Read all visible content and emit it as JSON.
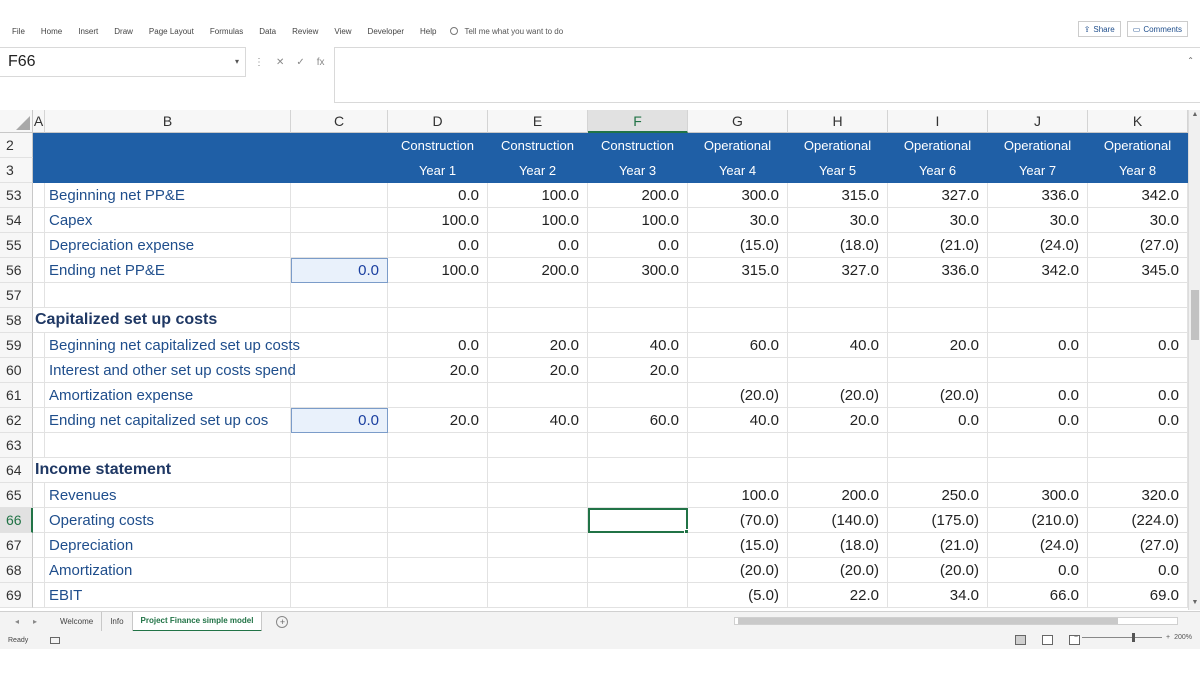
{
  "ribbon": {
    "tabs": [
      "File",
      "Home",
      "Insert",
      "Draw",
      "Page Layout",
      "Formulas",
      "Data",
      "Review",
      "View",
      "Developer",
      "Help"
    ],
    "tell_me": "Tell me what you want to do",
    "share": "Share",
    "comments": "Comments"
  },
  "namebox": {
    "value": "F66"
  },
  "formula_bar": {
    "fx": "fx",
    "content": ""
  },
  "columns": [
    {
      "letter": "A",
      "selected": false
    },
    {
      "letter": "B",
      "selected": false
    },
    {
      "letter": "C",
      "selected": false
    },
    {
      "letter": "D",
      "selected": false
    },
    {
      "letter": "E",
      "selected": false
    },
    {
      "letter": "F",
      "selected": true
    },
    {
      "letter": "G",
      "selected": false
    },
    {
      "letter": "H",
      "selected": false
    },
    {
      "letter": "I",
      "selected": false
    },
    {
      "letter": "J",
      "selected": false
    },
    {
      "letter": "K",
      "selected": false
    }
  ],
  "header_rows": [
    {
      "row": "2",
      "values": [
        "Construction",
        "Construction",
        "Construction",
        "Operational",
        "Operational",
        "Operational",
        "Operational",
        "Operational"
      ]
    },
    {
      "row": "3",
      "values": [
        "Year 1",
        "Year 2",
        "Year 3",
        "Year 4",
        "Year 5",
        "Year 6",
        "Year 7",
        "Year 8"
      ]
    }
  ],
  "rows": [
    {
      "row": "53",
      "type": "line",
      "label": "Beginning net PP&E",
      "c": "",
      "values": [
        "0.0",
        "100.0",
        "200.0",
        "300.0",
        "315.0",
        "327.0",
        "336.0",
        "342.0"
      ]
    },
    {
      "row": "54",
      "type": "line",
      "label": "Capex",
      "c": "",
      "values": [
        "100.0",
        "100.0",
        "100.0",
        "30.0",
        "30.0",
        "30.0",
        "30.0",
        "30.0"
      ]
    },
    {
      "row": "55",
      "type": "line",
      "label": "Depreciation expense",
      "c": "",
      "values": [
        "0.0",
        "0.0",
        "0.0",
        "(15.0)",
        "(18.0)",
        "(21.0)",
        "(24.0)",
        "(27.0)"
      ]
    },
    {
      "row": "56",
      "type": "line",
      "label": "Ending net PP&E",
      "c": "0.0",
      "values": [
        "100.0",
        "200.0",
        "300.0",
        "315.0",
        "327.0",
        "336.0",
        "342.0",
        "345.0"
      ]
    },
    {
      "row": "57",
      "type": "blank",
      "label": "",
      "c": "",
      "values": [
        "",
        "",
        "",
        "",
        "",
        "",
        "",
        ""
      ]
    },
    {
      "row": "58",
      "type": "section",
      "label": "Capitalized set up costs",
      "c": "",
      "values": [
        "",
        "",
        "",
        "",
        "",
        "",
        "",
        ""
      ]
    },
    {
      "row": "59",
      "type": "line",
      "label": "Beginning net capitalized set up costs",
      "c": "",
      "values": [
        "0.0",
        "20.0",
        "40.0",
        "60.0",
        "40.0",
        "20.0",
        "0.0",
        "0.0"
      ]
    },
    {
      "row": "60",
      "type": "line",
      "label": "Interest and other set up costs spend",
      "c": "",
      "values": [
        "20.0",
        "20.0",
        "20.0",
        "",
        "",
        "",
        "",
        ""
      ]
    },
    {
      "row": "61",
      "type": "line",
      "label": "Amortization expense",
      "c": "",
      "values": [
        "",
        "",
        "",
        "(20.0)",
        "(20.0)",
        "(20.0)",
        "0.0",
        "0.0"
      ]
    },
    {
      "row": "62",
      "type": "line",
      "label": "Ending net capitalized set up cos",
      "c": "0.0",
      "values": [
        "20.0",
        "40.0",
        "60.0",
        "40.0",
        "20.0",
        "0.0",
        "0.0",
        "0.0"
      ]
    },
    {
      "row": "63",
      "type": "blank",
      "label": "",
      "c": "",
      "values": [
        "",
        "",
        "",
        "",
        "",
        "",
        "",
        ""
      ]
    },
    {
      "row": "64",
      "type": "section",
      "label": "Income statement",
      "c": "",
      "values": [
        "",
        "",
        "",
        "",
        "",
        "",
        "",
        ""
      ]
    },
    {
      "row": "65",
      "type": "line",
      "label": "Revenues",
      "c": "",
      "values": [
        "",
        "",
        "",
        "100.0",
        "200.0",
        "250.0",
        "300.0",
        "320.0"
      ]
    },
    {
      "row": "66",
      "type": "line",
      "label": "Operating costs",
      "c": "",
      "values": [
        "",
        "",
        "",
        "(70.0)",
        "(140.0)",
        "(175.0)",
        "(210.0)",
        "(224.0)"
      ],
      "selected": true
    },
    {
      "row": "67",
      "type": "line",
      "label": "Depreciation",
      "c": "",
      "values": [
        "",
        "",
        "",
        "(15.0)",
        "(18.0)",
        "(21.0)",
        "(24.0)",
        "(27.0)"
      ]
    },
    {
      "row": "68",
      "type": "line",
      "label": "Amortization",
      "c": "",
      "values": [
        "",
        "",
        "",
        "(20.0)",
        "(20.0)",
        "(20.0)",
        "0.0",
        "0.0"
      ]
    },
    {
      "row": "69",
      "type": "line",
      "label": "EBIT",
      "c": "",
      "values": [
        "",
        "",
        "",
        "(5.0)",
        "22.0",
        "34.0",
        "66.0",
        "69.0"
      ]
    }
  ],
  "active_cell": {
    "column": "F",
    "row": "66"
  },
  "sheet_tabs": [
    {
      "label": "Welcome",
      "active": false
    },
    {
      "label": "Info",
      "active": false
    },
    {
      "label": "Project Finance simple model",
      "active": true
    }
  ],
  "status": {
    "ready": "Ready",
    "zoom": "200%"
  },
  "colors": {
    "accent": "#217346",
    "band": "#1f5fa6",
    "label_text": "#1f4e8c",
    "section_text": "#1f3864",
    "input_fill": "#e9f1fb"
  }
}
